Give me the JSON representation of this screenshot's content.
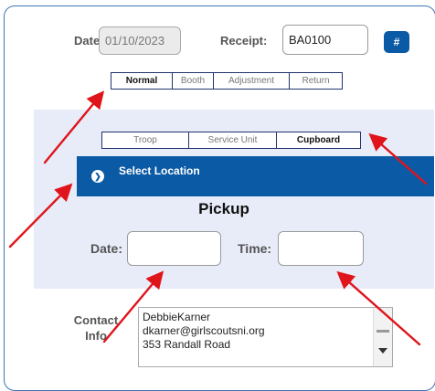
{
  "header": {
    "date_label": "Date:",
    "date_value": "01/10/2023",
    "receipt_label": "Receipt:",
    "receipt_value": "BA0100",
    "hash_button": "#"
  },
  "type_tabs": [
    {
      "label": "Normal",
      "active": true
    },
    {
      "label": "Booth",
      "active": false
    },
    {
      "label": "Adjustment",
      "active": false
    },
    {
      "label": "Return",
      "active": false
    }
  ],
  "source_tabs": [
    {
      "label": "Troop",
      "active": false
    },
    {
      "label": "Service Unit",
      "active": false
    },
    {
      "label": "Cupboard",
      "active": true
    }
  ],
  "location": {
    "title": "Select Location",
    "icon": "chevron-down-circle-icon"
  },
  "pickup": {
    "title": "Pickup",
    "date_label": "Date:",
    "date_value": "",
    "time_label": "Time:",
    "time_value": ""
  },
  "contact": {
    "label_line1": "Contact",
    "label_line2": "Info",
    "lines": [
      "DebbieKarner",
      "dkarner@girlscoutsni.org",
      "353 Randall Road"
    ]
  },
  "colors": {
    "accent": "#0b5aa5",
    "panel": "#e7ecf8",
    "annotation_arrow": "#e0141b"
  }
}
